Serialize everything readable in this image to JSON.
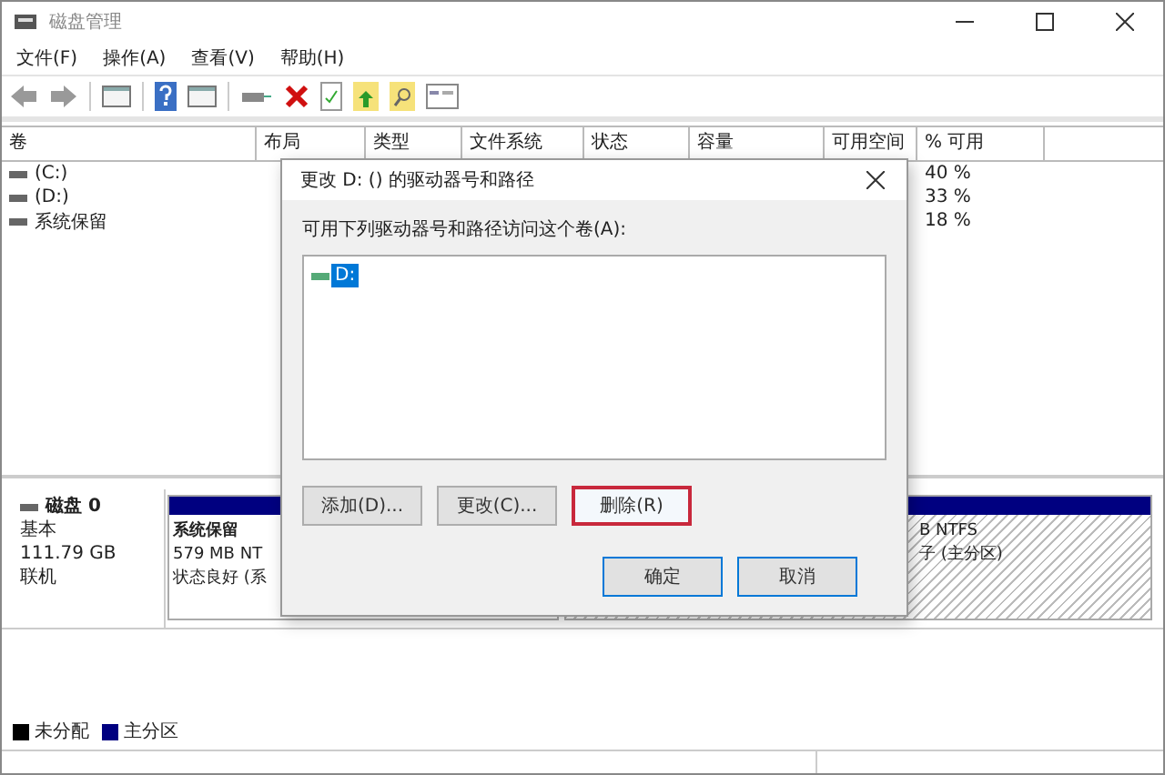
{
  "window": {
    "title": "磁盘管理"
  },
  "menu": [
    "文件(F)",
    "操作(A)",
    "查看(V)",
    "帮助(H)"
  ],
  "toolbar": [
    {
      "kind": "back"
    },
    {
      "kind": "forward"
    },
    {
      "kind": "pane"
    },
    {
      "kind": "help"
    },
    {
      "kind": "pane"
    },
    {
      "kind": "connect"
    },
    {
      "kind": "delete"
    },
    {
      "kind": "check"
    },
    {
      "kind": "folder-up"
    },
    {
      "kind": "folder-search"
    },
    {
      "kind": "properties"
    }
  ],
  "volume_table": {
    "columns": [
      "卷",
      "布局",
      "类型",
      "文件系统",
      "状态",
      "容量",
      "可用空间",
      "% 可用"
    ],
    "rows": [
      {
        "volume": "(C:)",
        "percent_free": "40 %"
      },
      {
        "volume": "(D:)",
        "percent_free": "33 %"
      },
      {
        "volume": "系统保留",
        "percent_free": "18 %"
      }
    ]
  },
  "disk": {
    "name": "磁盘 0",
    "type": "基本",
    "size": "111.79 GB",
    "status": "联机",
    "partitions": [
      {
        "lines": [
          "系统保留",
          "579 MB NT",
          "状态良好 (系"
        ],
        "selected": false
      },
      {
        "lines": [
          "B NTFS",
          "子 (主分区)"
        ],
        "selected": true
      }
    ]
  },
  "legend": [
    {
      "label": "未分配",
      "color": "#000000"
    },
    {
      "label": "主分区",
      "color": "#000080"
    }
  ],
  "dialog": {
    "title": "更改 D: () 的驱动器号和路径",
    "prompt": "可用下列驱动器号和路径访问这个卷(A):",
    "items": [
      {
        "label": "D:",
        "selected": true
      }
    ],
    "buttons": [
      {
        "label": "添加(D)...",
        "highlighted": false
      },
      {
        "label": "更改(C)...",
        "highlighted": false
      },
      {
        "label": "删除(R)",
        "highlighted": true
      }
    ],
    "footer_buttons": [
      "确定",
      "取消"
    ]
  }
}
